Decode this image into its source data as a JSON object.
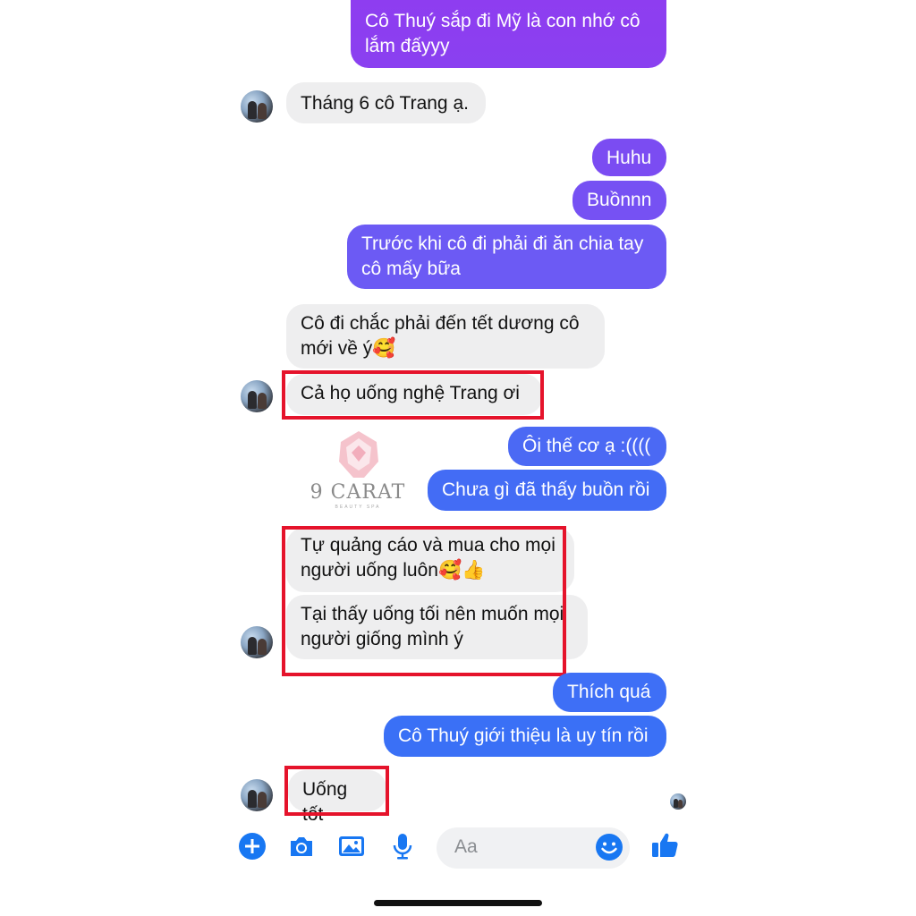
{
  "colors": {
    "outgoing_purple": "#8a3ef0",
    "outgoing_blue": "#3c6ef6",
    "incoming_bg": "#eeeeef",
    "highlight_red": "#e5132b",
    "toolbar_blue": "#1877f2"
  },
  "messages": [
    {
      "side": "out",
      "text": "Cô Thuý sắp đi Mỹ là con nhớ cô\nlắm đấyyy"
    },
    {
      "side": "in",
      "text": "Tháng 6 cô Trang ạ."
    },
    {
      "side": "out",
      "text": "Huhu"
    },
    {
      "side": "out",
      "text": "Buồnnn"
    },
    {
      "side": "out",
      "text": "Trước khi cô đi phải đi ăn chia tay\ncô mấy bữa"
    },
    {
      "side": "in",
      "text": "Cô đi chắc phải đến tết dương cô\nmới về ý🥰"
    },
    {
      "side": "in",
      "text": "Cả họ uống nghệ Trang ơi"
    },
    {
      "side": "out",
      "text": "Ôi thế cơ ạ :(((("
    },
    {
      "side": "out",
      "text": "Chưa gì đã thấy buồn rồi"
    },
    {
      "side": "in",
      "text": "Tự quảng cáo và mua cho mọi\nngười uống luôn🥰👍"
    },
    {
      "side": "in",
      "text": "Tại thấy uống tối nên muốn mọi\nngười giống mình ý"
    },
    {
      "side": "out",
      "text": "Thích quá"
    },
    {
      "side": "out",
      "text": "Cô Thuý giới thiệu là uy tín rồi"
    },
    {
      "side": "in",
      "text": "Uống tốt"
    }
  ],
  "watermark": {
    "brand": "9 CARAT",
    "tagline": "BEAUTY SPA"
  },
  "composer": {
    "placeholder": "Aa",
    "icons": [
      "plus-icon",
      "camera-icon",
      "image-icon",
      "microphone-icon",
      "emoji-icon",
      "thumbs-up-icon"
    ]
  }
}
